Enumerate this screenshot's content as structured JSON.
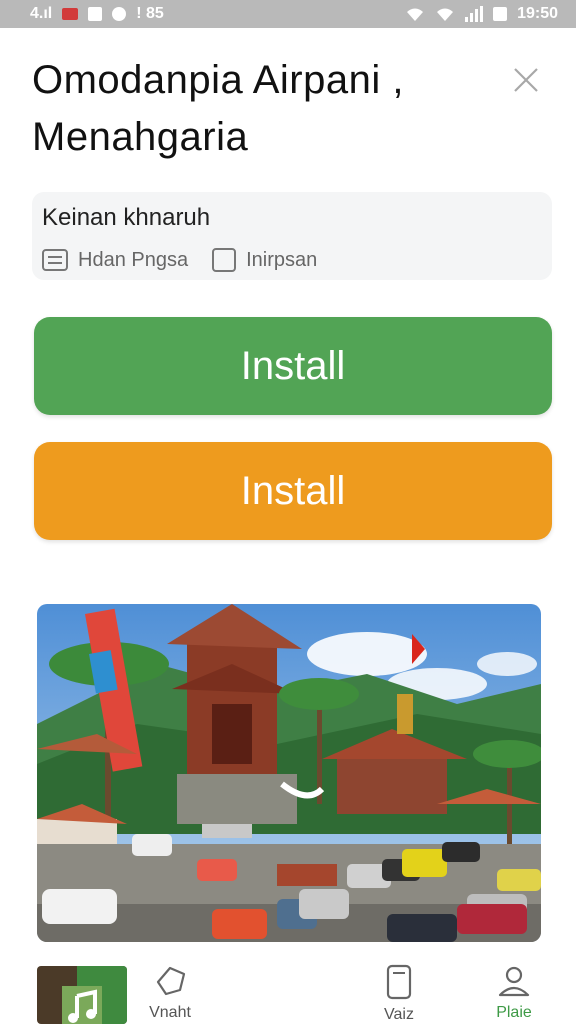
{
  "status_bar": {
    "left_text": "4.ıl",
    "left_extra": "! 85",
    "time": "19:50"
  },
  "app": {
    "title": "Omodanpia Airpani , Menahgaria"
  },
  "info": {
    "name": "Keinan khnaruh",
    "meta": [
      {
        "label": "Hdan Pngsa",
        "icon": "list-icon"
      },
      {
        "label": "Inirpsan",
        "icon": "checkbox-icon"
      }
    ]
  },
  "buttons": {
    "install_primary": "Install",
    "install_secondary": "Install"
  },
  "hero": {
    "icon": "temple-market-photo"
  },
  "bottom_nav": {
    "items": [
      {
        "label": "Vnaht",
        "icon": "tag-icon"
      },
      {
        "label": "Vaiz",
        "icon": "phone-icon"
      },
      {
        "label": "Plaie",
        "icon": "profile-icon"
      }
    ],
    "accent": "#3e9a46"
  },
  "colors": {
    "green": "#52a455",
    "orange": "#ee9b1e",
    "status_bar": "#b9b9b9"
  }
}
